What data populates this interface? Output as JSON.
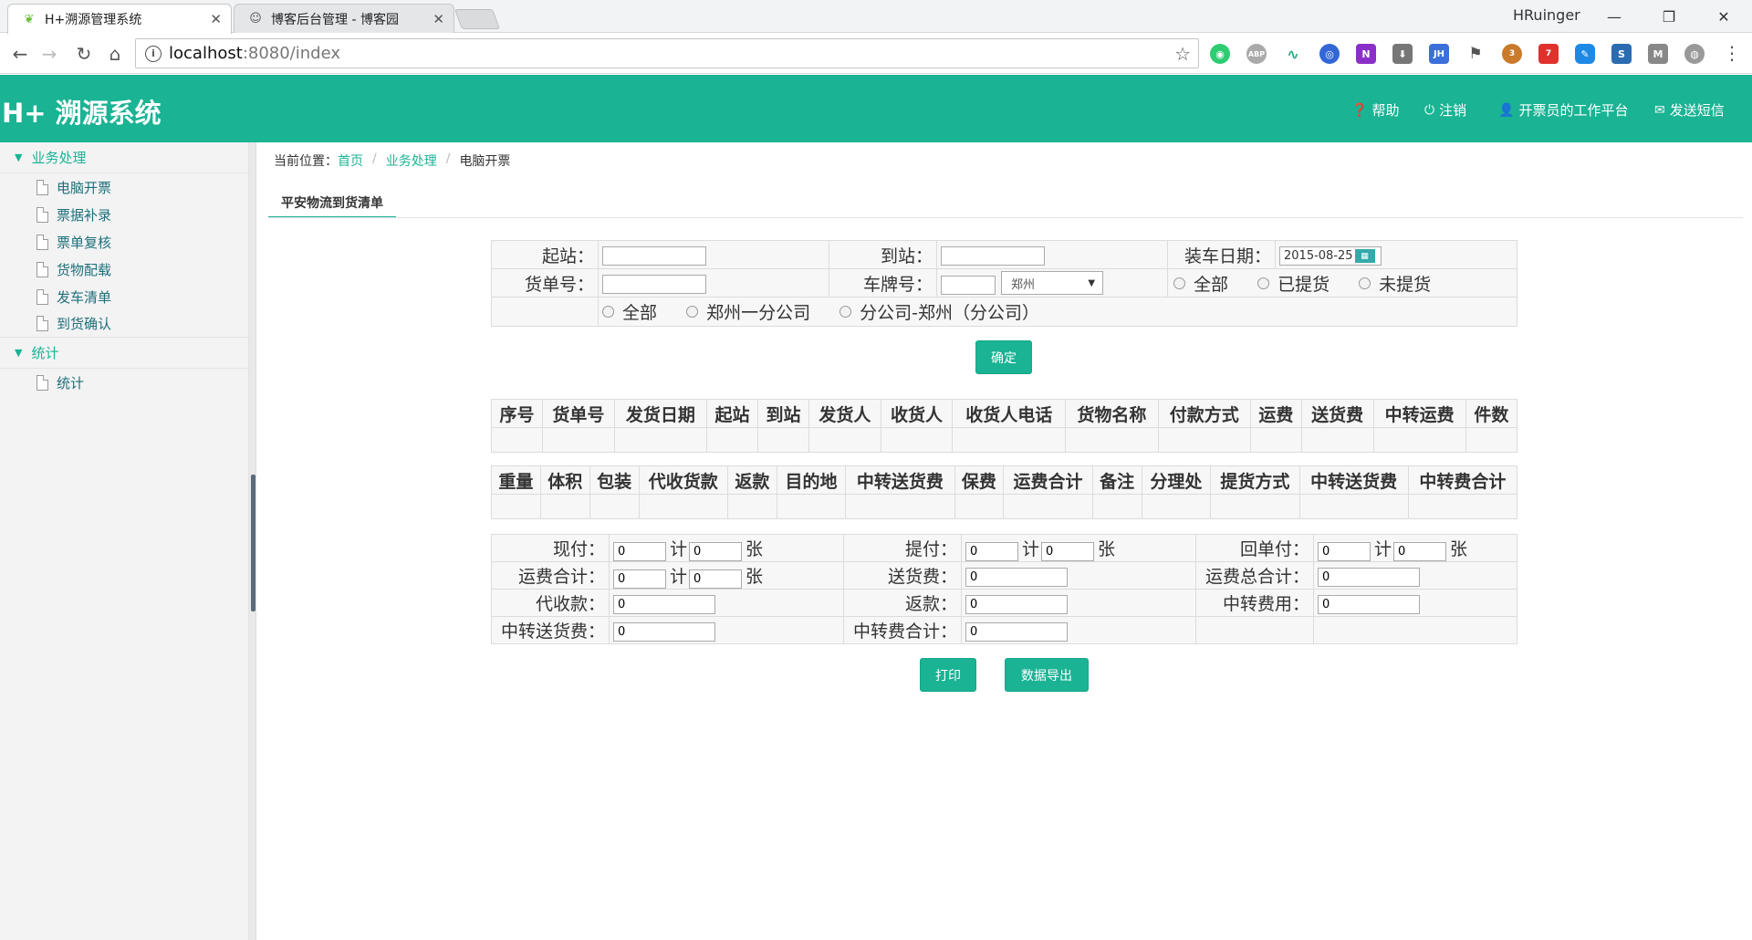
{
  "browser": {
    "tabs": [
      {
        "title": "H+溯源管理系统",
        "active": true
      },
      {
        "title": "博客后台管理 - 博客园",
        "active": false
      }
    ],
    "user": "HRuinger",
    "url_host": "localhost",
    "url_path": ":8080/index",
    "info_glyph": "i",
    "ext_badges": {
      "ext1": "3",
      "ext2": "7"
    }
  },
  "header": {
    "logo": "H+ 溯源系统",
    "nav": [
      {
        "label": "帮助",
        "icon": "help-icon"
      },
      {
        "label": "注销",
        "icon": "power-icon"
      },
      {
        "label": "开票员的工作平台",
        "icon": "user-icon"
      },
      {
        "label": "发送短信",
        "icon": "mail-icon"
      }
    ]
  },
  "sidebar": {
    "groups": [
      {
        "label": "业务处理",
        "items": [
          "电脑开票",
          "票据补录",
          "票单复核",
          "货物配载",
          "发车清单",
          "到货确认"
        ]
      },
      {
        "label": "统计",
        "items": [
          "统计"
        ]
      }
    ]
  },
  "breadcrumb": {
    "prefix": "当前位置：",
    "items": [
      "首页",
      "业务处理",
      "电脑开票"
    ]
  },
  "subtab": "平安物流到货清单",
  "query": {
    "start_label": "起站：",
    "end_label": "到站：",
    "date_label": "装车日期：",
    "date_value": "2015-08-25",
    "cargo_no_label": "货单号：",
    "plate_label": "车牌号：",
    "plate_city": "郑州",
    "pickup_options": [
      "全部",
      "已提货",
      "未提货"
    ],
    "company_options": [
      "全部",
      "郑州一分公司",
      "分公司-郑州（分公司）"
    ],
    "confirm_button": "确定"
  },
  "grid1": {
    "headers": [
      "序号",
      "货单号",
      "发货日期",
      "起站",
      "到站",
      "发货人",
      "收货人",
      "收货人电话",
      "货物名称",
      "付款方式",
      "运费",
      "送货费",
      "中转运费",
      "件数"
    ]
  },
  "grid2": {
    "headers": [
      "重量",
      "体积",
      "包装",
      "代收货款",
      "返款",
      "目的地",
      "中转送货费",
      "保费",
      "运费合计",
      "备注",
      "分理处",
      "提货方式",
      "中转送货费",
      "中转费合计"
    ]
  },
  "summary": {
    "unit_ji": "计",
    "unit_zhang": "张",
    "xianfu": {
      "label": "现付：",
      "amount": "0",
      "count": "0"
    },
    "tifu": {
      "label": "提付：",
      "amount": "0",
      "count": "0"
    },
    "huidanfu": {
      "label": "回单付：",
      "amount": "0",
      "count": "0"
    },
    "yunfei_heji": {
      "label": "运费合计：",
      "amount": "0",
      "count": "0"
    },
    "songhuofei": {
      "label": "送货费：",
      "value": "0"
    },
    "yunfei_zongheji": {
      "label": "运费总合计：",
      "value": "0"
    },
    "daishoukuan": {
      "label": "代收款：",
      "value": "0"
    },
    "fankuan": {
      "label": "返款：",
      "value": "0"
    },
    "zhongzhuan_feiyong": {
      "label": "中转费用：",
      "value": "0"
    },
    "zhongzhuan_songhuofei": {
      "label": "中转送货费：",
      "value": "0"
    },
    "zhongzhuanfei_heji": {
      "label": "中转费合计：",
      "value": "0"
    }
  },
  "actions": {
    "print": "打印",
    "export": "数据导出"
  },
  "colors": {
    "accent": "#1ab394"
  }
}
